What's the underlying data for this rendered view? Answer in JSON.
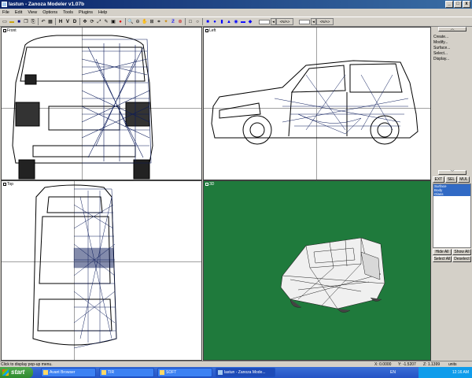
{
  "window": {
    "title": "lastun - Zanoza Modeler v1.07b",
    "min": "_",
    "max": "□",
    "close": "x"
  },
  "menu": [
    "File",
    "Edit",
    "View",
    "Options",
    "Tools",
    "Plugins",
    "Help"
  ],
  "toolbar": {
    "h": "H",
    "v": "V",
    "d": "D",
    "combo1": "<N/A>",
    "combo2": "<N/A>"
  },
  "viewports": {
    "front": "Front",
    "left": "Left",
    "top": "Top",
    "threed": "3D"
  },
  "side": {
    "create": "Create...",
    "modify": "Modify...",
    "surface": "Surface...",
    "select": "Select...",
    "display": "Display...",
    "tabs": [
      "EXT",
      "SEL",
      "MUL"
    ],
    "list": [
      "Surface",
      "Body",
      "Glass"
    ],
    "hide_all": "Hide All",
    "show_all": "Show All",
    "select_all": "Select All",
    "deselect": "Deselect"
  },
  "status": {
    "message": "Click to display pop-up menu.",
    "x": "X: 0.0000",
    "y": "Y: -1.5207",
    "z": "Z: 1.1399",
    "units": "units"
  },
  "taskbar": {
    "start": "start",
    "tasks": [
      "Avant Browser",
      "TIR",
      "SOFT",
      "lastun - Zanoza Mode..."
    ],
    "lang": "EN",
    "clock": "12:16 AM"
  },
  "colors": {
    "viewport3d": "#1f7a3c",
    "titlebar": "#0a246a",
    "taskbar": "#2553c5",
    "start": "#3a9a3a"
  }
}
